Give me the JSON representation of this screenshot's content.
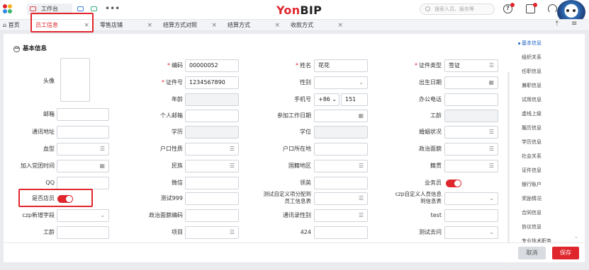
{
  "topbar": {
    "brand_you": "Yon",
    "brand_bip": "BIP",
    "workbench_label": "工作台",
    "more": "•••",
    "search_placeholder": "搜索人员、服务等",
    "help_icon": "?"
  },
  "tabs": {
    "home": "首页",
    "items": [
      "员工信息",
      "零售店铺",
      "结算方式对照",
      "结算方式",
      "收款方式"
    ]
  },
  "section": {
    "title": "基本信息"
  },
  "form": {
    "photo_label": "头像",
    "code_label": "编码",
    "code_value": "00000052",
    "name_label": "姓名",
    "name_value": "花花",
    "idtype_label": "证件类型",
    "idtype_value": "签证",
    "idno_label": "证件号",
    "idno_value": "1234567890",
    "gender_label": "性别",
    "birthday_label": "出生日期",
    "age_label": "年龄",
    "mobile_label": "手机号",
    "mobile_prefix": "+86",
    "mobile_value": "151",
    "officephone_label": "办公电话",
    "email_label": "邮箱",
    "personal_email_label": "个人邮箱",
    "join_date_label": "参加工作日期",
    "seniority_label": "工龄",
    "address_label": "通讯地址",
    "education_label": "学历",
    "degree_label": "学位",
    "marital_label": "婚姻状况",
    "blood_label": "血型",
    "hukou_type_label": "户口性质",
    "hukou_place_label": "户口所在地",
    "political_label": "政治面貌",
    "party_date_label": "加入党团时间",
    "nation_label": "民族",
    "country_label": "国籍地区",
    "native_label": "籍贯",
    "qq_label": "QQ",
    "wechat_label": "微信",
    "linkedin_label": "领英",
    "salesman_label": "业务员",
    "is_clerk_label": "是否店员",
    "test999_label": "测试999",
    "custom_doc_label": "测试自定义项分配到员工信息表",
    "custom_doc_label2": "czp自定义人员信息到信息表",
    "czp_new_label": "czp新增字段",
    "political_code_label": "政治面貌编码",
    "address_type_label": "通讯录性别",
    "test_label": "test",
    "seniority2_label": "工龄",
    "project_label": "项目",
    "num424_label": "424",
    "test_go_label": "测试去问"
  },
  "rnav": [
    "基本信息",
    "组织关系",
    "任职信息",
    "兼职信息",
    "试用信息",
    "虚线上级",
    "履历信息",
    "学历信息",
    "社会关系",
    "证件信息",
    "银行账户",
    "奖励情况",
    "合同信息",
    "协议信息",
    "专业技术职务",
    "..."
  ],
  "footer": {
    "cancel": "取消",
    "save": "保存"
  },
  "colors": {
    "accent": "#e0262d",
    "nav_active": "#1e63c7"
  }
}
